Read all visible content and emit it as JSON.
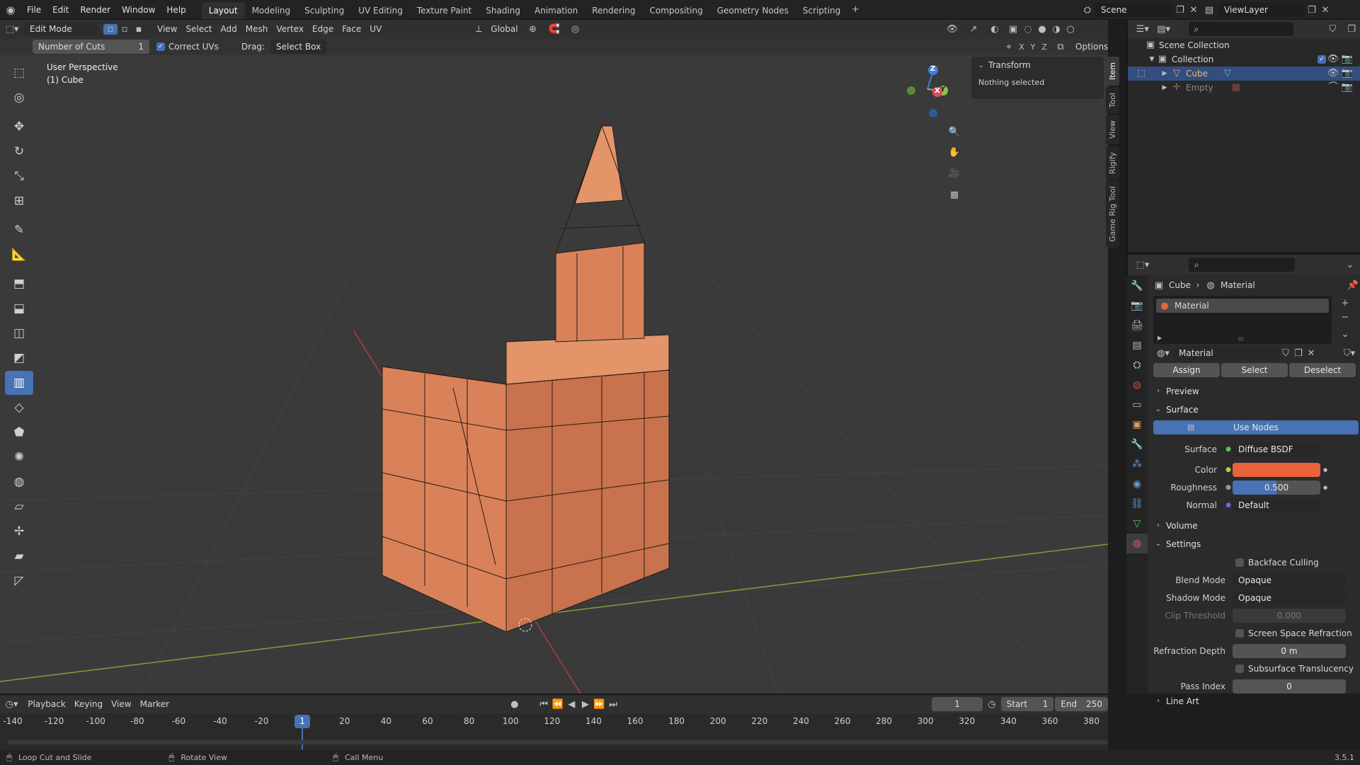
{
  "topbar": {
    "menus": [
      "File",
      "Edit",
      "Render",
      "Window",
      "Help"
    ],
    "workspaces": [
      "Layout",
      "Modeling",
      "Sculpting",
      "UV Editing",
      "Texture Paint",
      "Shading",
      "Animation",
      "Rendering",
      "Compositing",
      "Geometry Nodes",
      "Scripting"
    ],
    "active_workspace": "Layout",
    "scene": "Scene",
    "view_layer": "ViewLayer"
  },
  "viewport_header": {
    "mode": "Edit Mode",
    "menus": [
      "View",
      "Select",
      "Add",
      "Mesh",
      "Vertex",
      "Edge",
      "Face",
      "UV"
    ],
    "transform_orientation": "Global",
    "axes": [
      "X",
      "Y",
      "Z"
    ],
    "options": "Options"
  },
  "tool_settings": {
    "cuts_label": "Number of Cuts",
    "cuts_value": "1",
    "correct_uvs": "Correct UVs",
    "drag_label": "Drag:",
    "drag_value": "Select Box"
  },
  "viewport": {
    "perspective": "User Perspective",
    "object": "(1) Cube",
    "gizmo": {
      "z": "Z",
      "x": "X",
      "y": "Y"
    },
    "accent_x": "#e04a5a",
    "accent_y": "#8bc34a",
    "accent_z": "#3f7fd8",
    "mesh_color": "#d9825a"
  },
  "npanel": {
    "title": "Transform",
    "text": "Nothing selected",
    "tabs": [
      "Item",
      "Tool",
      "View",
      "Rigify",
      "Game Rig Tool"
    ]
  },
  "outliner": {
    "root": "Scene Collection",
    "collection": "Collection",
    "items": [
      "Cube",
      "Empty"
    ]
  },
  "properties": {
    "breadcrumb": [
      "Cube",
      "Material"
    ],
    "slot": "Material",
    "material_name": "Material",
    "assign": "Assign",
    "select": "Select",
    "deselect": "Deselect",
    "sections": {
      "preview": "Preview",
      "surface": "Surface",
      "volume": "Volume",
      "settings": "Settings",
      "line_art": "Line Art"
    },
    "use_nodes": "Use Nodes",
    "surface_label": "Surface",
    "surface_value": "Diffuse BSDF",
    "color_label": "Color",
    "color_value": "#e8633a",
    "roughness_label": "Roughness",
    "roughness_value": "0.500",
    "normal_label": "Normal",
    "normal_value": "Default",
    "backface_culling": "Backface Culling",
    "blend_mode_label": "Blend Mode",
    "blend_mode_value": "Opaque",
    "shadow_mode_label": "Shadow Mode",
    "shadow_mode_value": "Opaque",
    "clip_threshold_label": "Clip Threshold",
    "clip_threshold_value": "0.000",
    "ssr": "Screen Space Refraction",
    "refraction_depth_label": "Refraction Depth",
    "refraction_depth_value": "0 m",
    "subsurface_translucency": "Subsurface Translucency",
    "pass_index_label": "Pass Index",
    "pass_index_value": "0"
  },
  "timeline": {
    "menus": [
      "Playback",
      "Keying",
      "View",
      "Marker"
    ],
    "current_frame": "1",
    "start_label": "Start",
    "start_value": "1",
    "end_label": "End",
    "end_value": "250",
    "ticks": [
      "-140",
      "-120",
      "-100",
      "-80",
      "-60",
      "-40",
      "-20",
      "1",
      "20",
      "40",
      "60",
      "80",
      "100",
      "120",
      "140",
      "160",
      "180",
      "200",
      "220",
      "240",
      "260",
      "280",
      "300",
      "320",
      "340",
      "360",
      "380"
    ]
  },
  "status": {
    "left": "Loop Cut and Slide",
    "middle": "Rotate View",
    "right": "Call Menu",
    "version": "3.5.1"
  }
}
